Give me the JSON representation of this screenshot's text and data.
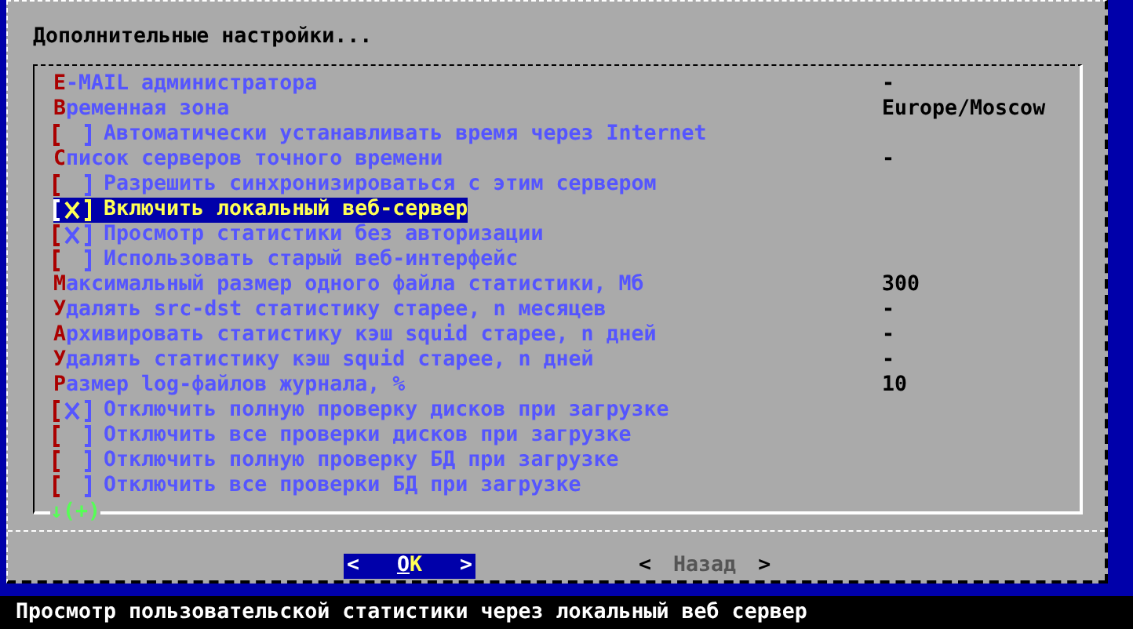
{
  "dialog": {
    "title": "Дополнительные настройки...",
    "items": [
      {
        "kind": "field",
        "label": "E-MAIL администратора",
        "value": "-",
        "selected": false
      },
      {
        "kind": "field",
        "label": "Временная зона",
        "value": "Europe/Moscow",
        "selected": false
      },
      {
        "kind": "checkbox",
        "label": "Автоматически устанавливать время через Internet",
        "checked": false,
        "selected": false
      },
      {
        "kind": "field",
        "label": "Список серверов точного времени",
        "value": "-",
        "selected": false
      },
      {
        "kind": "checkbox",
        "label": "Разрешить синхронизироваться с этим сервером",
        "checked": false,
        "selected": false
      },
      {
        "kind": "checkbox",
        "label": "Включить локальный веб-сервер",
        "checked": true,
        "selected": true
      },
      {
        "kind": "checkbox",
        "label": "Просмотр статистики без авторизации",
        "checked": true,
        "selected": false
      },
      {
        "kind": "checkbox",
        "label": "Использовать старый веб-интерфейс",
        "checked": false,
        "selected": false
      },
      {
        "kind": "field",
        "label": "Максимальный размер одного файла статистики, Мб",
        "value": "300",
        "selected": false
      },
      {
        "kind": "field",
        "label": "Удалять src-dst статистику старее, n месяцев",
        "value": "-",
        "selected": false
      },
      {
        "kind": "field",
        "label": "Архивировать статистику кэш squid старее, n дней",
        "value": "-",
        "selected": false
      },
      {
        "kind": "field",
        "label": "Удалять статистику кэш squid старее, n дней",
        "value": "-",
        "selected": false
      },
      {
        "kind": "field",
        "label": "Размер log-файлов журнала, %",
        "value": "10",
        "selected": false
      },
      {
        "kind": "checkbox",
        "label": "Отключить полную проверку дисков при загрузке",
        "checked": true,
        "selected": false
      },
      {
        "kind": "checkbox",
        "label": "Отключить все проверки дисков при загрузке",
        "checked": false,
        "selected": false
      },
      {
        "kind": "checkbox",
        "label": "Отключить полную проверку БД при загрузке",
        "checked": false,
        "selected": false
      },
      {
        "kind": "checkbox",
        "label": "Отключить все проверки БД при загрузке",
        "checked": false,
        "selected": false
      }
    ],
    "scroll_indicator": "↓(+)",
    "buttons": [
      {
        "left": "<",
        "label": "OK",
        "right": ">",
        "selected": true
      },
      {
        "left": "<",
        "label": "Назад",
        "right": ">",
        "selected": false
      }
    ]
  },
  "status_bar": "Просмотр пользовательской статистики через локальный веб сервер"
}
